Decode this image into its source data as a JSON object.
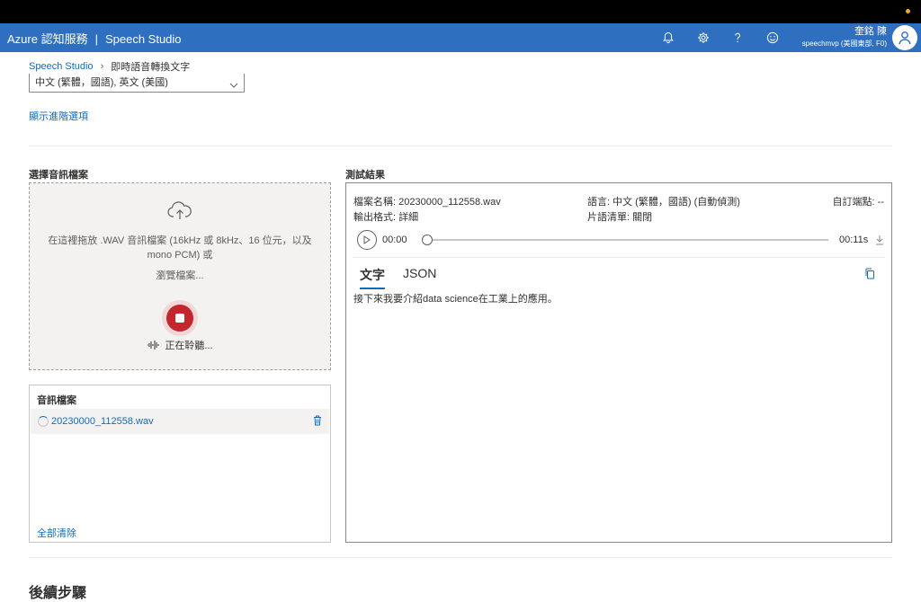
{
  "topbar": {
    "brand": "Azure 認知服務",
    "separator": "|",
    "product": "Speech Studio",
    "icons": [
      "bell-icon",
      "gear-icon",
      "help-icon",
      "smiley-icon"
    ],
    "user_name": "奎銘 陳",
    "user_sub": "speechmvp (美國東部, F0)"
  },
  "breadcrumb": {
    "root": "Speech Studio",
    "current": "即時語音轉換文字"
  },
  "language": {
    "selected": "中文 (繁體，國語), 英文 (美國)"
  },
  "advanced_link": "顯示進階選項",
  "upload": {
    "section_label": "選擇音訊檔案",
    "instructions": "在這裡拖放 .WAV 音訊檔案 (16kHz 或 8kHz、16 位元，以及 mono PCM) 或",
    "browse": "瀏覽檔案...",
    "listening": "正在聆聽..."
  },
  "files": {
    "header": "音訊檔案",
    "items": [
      {
        "name": "20230000_112558.wav"
      }
    ],
    "clear_all": "全部清除"
  },
  "results": {
    "section_label": "測試結果",
    "file_name_label": "檔案名稱:",
    "file_name": "20230000_112558.wav",
    "language_label": "語言:",
    "language": "中文 (繁體，國語) (自動偵測)",
    "endpoint_label": "自訂端點:",
    "endpoint": "--",
    "output_label": "輸出格式:",
    "output": "詳細",
    "phrase_label": "片語清單:",
    "phrase": "關閉",
    "time_start": "00:00",
    "time_end": "00:11s",
    "progress": 0,
    "tabs": [
      "文字",
      "JSON"
    ],
    "active_tab": "文字",
    "transcript": "接下來我要介紹data science在工業上的應用。"
  },
  "next_steps": "後續步驟",
  "colors": {
    "appbar": "#2f6fbf",
    "link": "#0f6cbd",
    "record": "#c4262e"
  }
}
